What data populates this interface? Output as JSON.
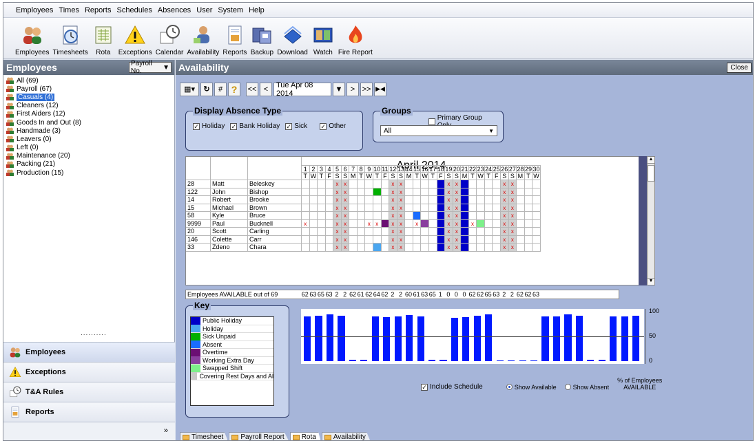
{
  "menu": [
    "Employees",
    "Times",
    "Reports",
    "Schedules",
    "Absences",
    "User",
    "System",
    "Help"
  ],
  "toolbar": [
    {
      "label": "Employees",
      "icon": "people-icon"
    },
    {
      "label": "Timesheets",
      "icon": "clock-sheet-icon"
    },
    {
      "label": "Rota",
      "icon": "rota-sheet-icon"
    },
    {
      "label": "Exceptions",
      "icon": "warning-icon"
    },
    {
      "label": "Calendar",
      "icon": "calendar-clock-icon"
    },
    {
      "label": "Availability",
      "icon": "availability-icon"
    },
    {
      "label": "Reports",
      "icon": "report-icon"
    },
    {
      "label": "Backup",
      "icon": "backup-icon"
    },
    {
      "label": "Download",
      "icon": "download-icon"
    },
    {
      "label": "Watch",
      "icon": "watch-icon"
    },
    {
      "label": "Fire Report",
      "icon": "fire-icon"
    }
  ],
  "left": {
    "title": "Employees",
    "sort_select": "Payroll No.",
    "tree": [
      "All (69)",
      "Payroll (67)",
      "Casuals (4)",
      "Cleaners (12)",
      "First Aiders (12)",
      "Goods In and Out (8)",
      "Handmade (3)",
      "Leavers (0)",
      "Left (0)",
      "Maintenance (20)",
      "Packing (21)",
      "Production (15)"
    ],
    "selected_index": 2,
    "grip": "..........",
    "nav": [
      {
        "label": "Employees",
        "icon": "people-icon"
      },
      {
        "label": "Exceptions",
        "icon": "warning-icon"
      },
      {
        "label": "T&A Rules",
        "icon": "calendar-clock-icon"
      },
      {
        "label": "Reports",
        "icon": "report-icon"
      }
    ],
    "nav_expand": "»"
  },
  "right": {
    "title": "Availability",
    "close": "Close",
    "tools": {
      "grid_icon": "▦",
      "refresh": "↻",
      "hash": "#",
      "help": "?",
      "first": "<<",
      "prev": "<",
      "date": "Tue  Apr 08 2014",
      "next": ">",
      "last": ">>",
      "goto_icon": "▶◀"
    },
    "absence": {
      "title": "Display Absence Type",
      "options": [
        {
          "label": "Holiday",
          "checked": true
        },
        {
          "label": "Bank Holiday",
          "checked": true
        },
        {
          "label": "Sick",
          "checked": true
        },
        {
          "label": "Other",
          "checked": true
        }
      ]
    },
    "groups": {
      "title": "Groups",
      "primary_only": "Primary Group Only",
      "primary_checked": false,
      "select": "All"
    },
    "grid": {
      "month": "April 2014",
      "days": [
        "1",
        "2",
        "3",
        "4",
        "5",
        "6",
        "7",
        "8",
        "9",
        "10",
        "11",
        "12",
        "13",
        "14",
        "15",
        "16",
        "17",
        "18",
        "19",
        "20",
        "21",
        "22",
        "23",
        "24",
        "25",
        "26",
        "27",
        "28",
        "29",
        "30"
      ],
      "weekdays": [
        "T",
        "W",
        "T",
        "F",
        "S",
        "S",
        "M",
        "T",
        "W",
        "T",
        "F",
        "S",
        "S",
        "M",
        "T",
        "W",
        "T",
        "F",
        "S",
        "S",
        "M",
        "T",
        "W",
        "T",
        "F",
        "S",
        "S",
        "M",
        "T",
        "W"
      ],
      "rows": [
        {
          "no": "28",
          "first": "Matt",
          "last": "Beleskey"
        },
        {
          "no": "122",
          "first": "John",
          "last": "Bishop"
        },
        {
          "no": "14",
          "first": "Robert",
          "last": "Brooke"
        },
        {
          "no": "15",
          "first": "Michael",
          "last": "Brown"
        },
        {
          "no": "58",
          "first": "Kyle",
          "last": "Bruce"
        },
        {
          "no": "9999",
          "first": "Paul",
          "last": "Bucknell"
        },
        {
          "no": "20",
          "first": "Scott",
          "last": "Carling"
        },
        {
          "no": "146",
          "first": "Colette",
          "last": "Carr"
        },
        {
          "no": "33",
          "first": "Zdeno",
          "last": "Chara"
        }
      ],
      "mark": "x"
    },
    "available": {
      "label": "Employees AVAILABLE out of 69",
      "values": [
        62,
        63,
        65,
        63,
        2,
        2,
        62,
        61,
        62,
        64,
        62,
        2,
        2,
        60,
        61,
        63,
        65,
        1,
        0,
        0,
        0,
        62,
        62,
        65,
        63,
        2,
        2,
        62,
        62,
        63
      ]
    },
    "key": {
      "title": "Key",
      "items": [
        {
          "label": "Public Holiday",
          "color": "#0000c8"
        },
        {
          "label": "Holiday",
          "color": "#4aa6f0"
        },
        {
          "label": "Sick Unpaid",
          "color": "#00b000"
        },
        {
          "label": "Absent",
          "color": "#1a6cff"
        },
        {
          "label": "Overtime",
          "color": "#6b0f73"
        },
        {
          "label": "Working Extra Day",
          "color": "#8a3f9e"
        },
        {
          "label": "Swapped Shift",
          "color": "#7df08a"
        },
        {
          "label": "Covering Rest Days and Al",
          "color": "#c9c9c9"
        }
      ]
    },
    "chart_axis": [
      "100",
      "50",
      "0"
    ],
    "bottom": {
      "include_schedule": "Include Schedule",
      "show_available": "Show Available",
      "show_absent": "Show Absent",
      "pct_line1": "% of Employees",
      "pct_line2": "AVAILABLE"
    },
    "tabs": [
      "Timesheet",
      "Payroll Report",
      "Rota",
      "Availability"
    ]
  }
}
